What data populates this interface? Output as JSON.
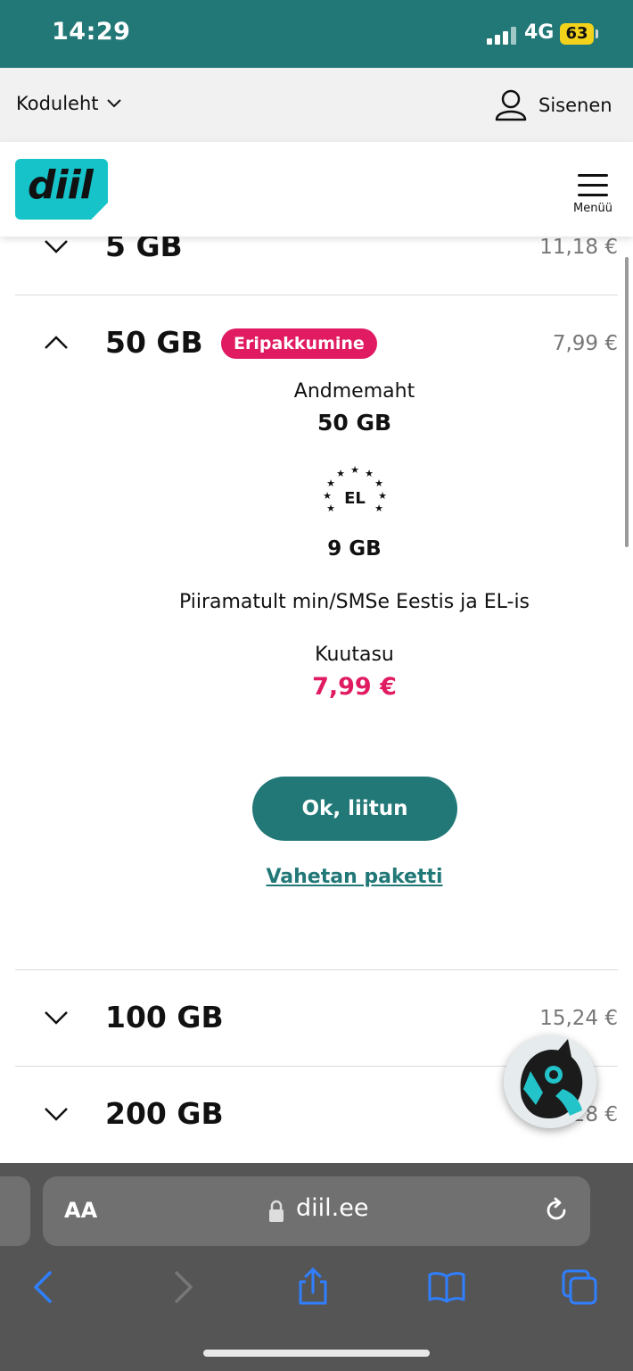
{
  "status_bar": {
    "time": "14:29",
    "network": "4G",
    "battery": "63"
  },
  "top_nav": {
    "home_label": "Koduleht",
    "login_label": "Sisenen"
  },
  "header": {
    "logo_text": "diil",
    "menu_label": "Menüü"
  },
  "packages": [
    {
      "title": "5 GB",
      "price": "11,18 €"
    },
    {
      "title": "50 GB",
      "price": "7,99 €",
      "badge": "Eripakkumine"
    },
    {
      "title": "100 GB",
      "price": "15,24 €"
    },
    {
      "title": "200 GB",
      "price": "0,28 €"
    }
  ],
  "details": {
    "data_label": "Andmemaht",
    "data_value": "50 GB",
    "eu_label": "EL",
    "eu_value": "9 GB",
    "unlimited_text": "Piiramatult min/SMSe Eestis ja EL-is",
    "fee_label": "Kuutasu",
    "fee_value": "7,99 €",
    "cta_label": "Ok, liitun",
    "change_link": "Vahetan paketti"
  },
  "browser": {
    "aa_label": "AA",
    "url": "diil.ee"
  },
  "colors": {
    "brand_teal": "#227877",
    "logo_cyan": "#16c3c9",
    "accent_pink": "#e01b62"
  }
}
